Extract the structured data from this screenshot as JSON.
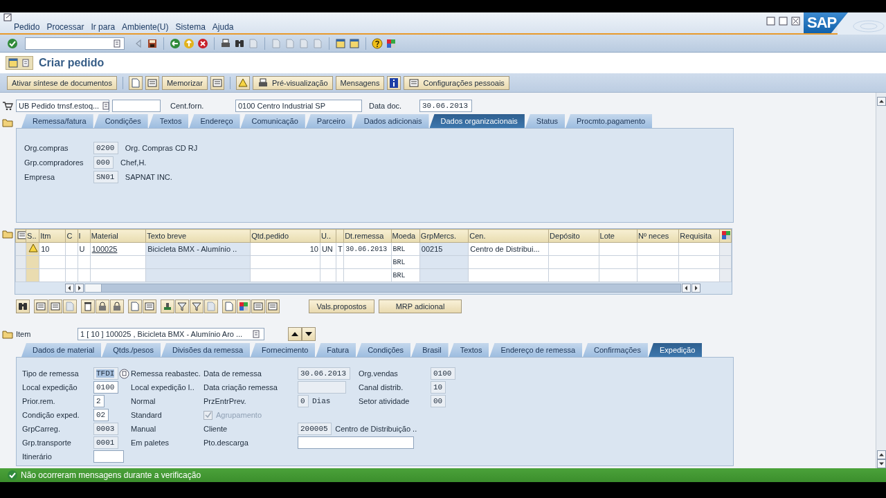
{
  "window": {
    "menu": [
      "Pedido",
      "Processar",
      "Ir para",
      "Ambiente(U)",
      "Sistema",
      "Ajuda"
    ],
    "logo": "SAP"
  },
  "title": "Criar pedido",
  "app_toolbar": [
    "Ativar síntese de documentos",
    "Memorizar",
    "Pré-visualização",
    "Mensagens",
    "Configurações pessoais"
  ],
  "header": {
    "doc_type": "UB Pedido trnsf.estoq...",
    "supplier_label": "Cent.forn.",
    "supplier": "0100 Centro Industrial SP",
    "date_label": "Data doc.",
    "date": "30.06.2013"
  },
  "header_tabs": [
    {
      "label": "Remessa/fatura",
      "selected": false
    },
    {
      "label": "Condições",
      "selected": false
    },
    {
      "label": "Textos",
      "selected": false
    },
    {
      "label": "Endereço",
      "selected": false
    },
    {
      "label": "Comunicação",
      "selected": false
    },
    {
      "label": "Parceiro",
      "selected": false
    },
    {
      "label": "Dados adicionais",
      "selected": false
    },
    {
      "label": "Dados organizacionais",
      "selected": true
    },
    {
      "label": "Status",
      "selected": false
    },
    {
      "label": "Procmto.pagamento",
      "selected": false
    }
  ],
  "header_fields": [
    {
      "label": "Org.compras",
      "value": "0200",
      "description": "Org. Compras CD RJ"
    },
    {
      "label": "Grp.compradores",
      "value": "000",
      "description": "Chef,H."
    },
    {
      "label": "Empresa",
      "value": "SN01",
      "description": "SAPNAT INC."
    }
  ],
  "items_table": {
    "columns": [
      {
        "header": "S..",
        "kind": "status"
      },
      {
        "header": "Itm",
        "kind": "text"
      },
      {
        "header": "C",
        "kind": "text"
      },
      {
        "header": "I",
        "kind": "text"
      },
      {
        "header": "Material",
        "kind": "link"
      },
      {
        "header": "Texto breve",
        "kind": "display"
      },
      {
        "header": "Qtd.pedido",
        "kind": "number"
      },
      {
        "header": "U..",
        "kind": "text"
      },
      {
        "kind": "text"
      },
      {
        "header": "Dt.remessa",
        "kind": "mono"
      },
      {
        "header": "Moeda",
        "kind": "mono"
      },
      {
        "header": "GrpMercs.",
        "kind": "display"
      },
      {
        "header": "Cen.",
        "kind": "text"
      },
      {
        "header": "Depósito",
        "kind": "text"
      },
      {
        "header": "Lote",
        "kind": "text"
      },
      {
        "header": "Nº neces",
        "kind": "text"
      },
      {
        "header": "Requisita",
        "kind": "text"
      }
    ],
    "rows": [
      {
        "warning": true,
        "cells": [
          null,
          "10",
          null,
          "U",
          "100025",
          "Bicicleta BMX - Alumínio ..",
          "10",
          "UN",
          "T",
          "30.06.2013",
          "BRL",
          "00215",
          "Centro de Distribui...",
          null,
          null,
          null,
          null
        ]
      },
      {
        "warning": false,
        "cells": [
          null,
          null,
          null,
          null,
          null,
          null,
          null,
          null,
          null,
          null,
          "BRL",
          null,
          null,
          null,
          null,
          null,
          null
        ]
      },
      {
        "warning": false,
        "cells": [
          null,
          null,
          null,
          null,
          null,
          null,
          null,
          null,
          null,
          null,
          "BRL",
          null,
          null,
          null,
          null,
          null,
          null
        ]
      }
    ]
  },
  "item_buttons": [
    "Vals.propostos",
    "MRP adicional"
  ],
  "item_selector": {
    "label": "Item",
    "value": "1 [ 10 ] 100025 , Bicicleta BMX - Alumínio Aro ..."
  },
  "item_tabs": [
    {
      "label": "Dados de material",
      "selected": false
    },
    {
      "label": "Qtds./pesos",
      "selected": false
    },
    {
      "label": "Divisões da remessa",
      "selected": false
    },
    {
      "label": "Fornecimento",
      "selected": false
    },
    {
      "label": "Fatura",
      "selected": false
    },
    {
      "label": "Condições",
      "selected": false
    },
    {
      "label": "Brasil",
      "selected": false
    },
    {
      "label": "Textos",
      "selected": false
    },
    {
      "label": "Endereço de remessa",
      "selected": false
    },
    {
      "label": "Confirmações",
      "selected": false
    },
    {
      "label": "Expedição",
      "selected": true
    }
  ],
  "item_fields": [
    {
      "cells": [
        {
          "kind": "help_field",
          "label": "Tipo de remessa",
          "value": "TFDI",
          "editable": false
        },
        {
          "kind": "text",
          "text": "Remessa reabastec."
        },
        {
          "kind": "field",
          "label": "Data de remessa",
          "value": "30.06.2013",
          "editable": false
        },
        {
          "kind": "field",
          "label": "Org.vendas",
          "value": "0100",
          "editable": false
        }
      ]
    },
    {
      "cells": [
        {
          "kind": "field",
          "label": "Local expedição",
          "value": "0100",
          "editable": true
        },
        {
          "kind": "text",
          "text": "Local expedição I.."
        },
        {
          "kind": "field",
          "label": "Data criação remessa",
          "editable": false
        },
        {
          "kind": "field",
          "label": "Canal distrib.",
          "value": "10",
          "editable": false
        }
      ]
    },
    {
      "cells": [
        {
          "kind": "field",
          "label": "Prior.rem.",
          "value": "2",
          "editable": true
        },
        {
          "kind": "text",
          "text": "Normal"
        },
        {
          "kind": "field",
          "label": "PrzEntrPrev.",
          "value": "0",
          "editable": false,
          "description": "Dias"
        },
        {
          "kind": "field",
          "label": "Setor atividade",
          "value": "00",
          "editable": false
        }
      ]
    },
    {
      "cells": [
        {
          "kind": "field",
          "label": "Condição exped.",
          "value": "02",
          "editable": true
        },
        {
          "kind": "text",
          "text": "Standard"
        },
        {
          "kind": "checkbox",
          "label": "Agrupamento",
          "checked": true,
          "disabled": true
        },
        null
      ]
    },
    {
      "cells": [
        {
          "kind": "field",
          "label": "GrpCarreg.",
          "value": "0003",
          "editable": false
        },
        {
          "kind": "text",
          "text": "Manual"
        },
        {
          "kind": "field",
          "label": "Cliente",
          "value": "200005",
          "editable": false,
          "description": "Centro de Distribuição .."
        },
        null
      ]
    },
    {
      "cells": [
        {
          "kind": "field",
          "label": "Grp.transporte",
          "value": "0001",
          "editable": false
        },
        {
          "kind": "text",
          "text": "Em paletes"
        },
        {
          "kind": "field",
          "label": "Pto.descarga",
          "editable": true
        },
        null
      ]
    },
    {
      "cells": [
        {
          "kind": "field",
          "label": "Itinerário",
          "editable": true
        },
        null,
        null,
        null
      ]
    }
  ],
  "status_bar": {
    "message": "Não ocorreram mensagens durante a verificação"
  }
}
